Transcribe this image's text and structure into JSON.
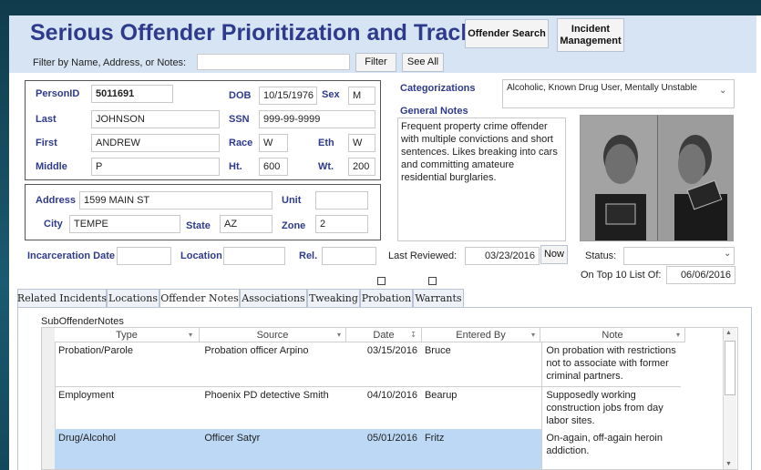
{
  "app": {
    "title": "Serious Offender Prioritization and Tracking"
  },
  "header": {
    "offender_search": "Offender Search",
    "incident_management": "Incident Management",
    "filter_label": "Filter by Name, Address, or Notes:",
    "filter_value": "",
    "filter_button": "Filter",
    "see_all_button": "See All"
  },
  "person": {
    "person_id_label": "PersonID",
    "person_id": "5011691",
    "dob_label": "DOB",
    "dob": "10/15/1976",
    "sex_label": "Sex",
    "sex": "M",
    "last_label": "Last",
    "last": "JOHNSON",
    "ssn_label": "SSN",
    "ssn": "999-99-9999",
    "first_label": "First",
    "first": "ANDREW",
    "race_label": "Race",
    "race": "W",
    "eth_label": "Eth",
    "eth": "W",
    "middle_label": "Middle",
    "middle": "P",
    "ht_label": "Ht.",
    "ht": "600",
    "wt_label": "Wt.",
    "wt": "200"
  },
  "address": {
    "address_label": "Address",
    "address": "1599 MAIN ST",
    "unit_label": "Unit",
    "unit": "",
    "city_label": "City",
    "city": "TEMPE",
    "state_label": "State",
    "state": "AZ",
    "zone_label": "Zone",
    "zone": "2"
  },
  "incarceration": {
    "date_label": "Incarceration Date",
    "date": "",
    "location_label": "Location",
    "location": "",
    "rel_label": "Rel.",
    "rel": ""
  },
  "categorizations": {
    "label": "Categorizations",
    "value": "Alcoholic, Known Drug User, Mentally Unstable"
  },
  "general_notes": {
    "label": "General Notes",
    "text": "Frequent property crime offender with multiple convictions and short sentences. Likes breaking into cars and committing amateure residential burglaries."
  },
  "review": {
    "last_reviewed_label": "Last Reviewed:",
    "last_reviewed": "03/23/2016",
    "now_button": "Now",
    "status_label": "Status:",
    "status": "",
    "top10_label": "On Top 10 List Of:",
    "top10_date": "06/06/2016"
  },
  "tabs": [
    {
      "label": "Related Incidents",
      "active": false
    },
    {
      "label": "Locations",
      "active": false
    },
    {
      "label": "Offender Notes",
      "active": true
    },
    {
      "label": "Associations",
      "active": false
    },
    {
      "label": "Tweaking",
      "active": false
    },
    {
      "label": "Probation",
      "active": false
    },
    {
      "label": "Warrants",
      "active": false
    }
  ],
  "subform": {
    "title": "SubOffenderNotes",
    "columns": [
      "Type",
      "Source",
      "Date",
      "Entered By",
      "Note"
    ],
    "rows": [
      {
        "type": "Probation/Parole",
        "source": "Probation officer Arpino",
        "date": "03/15/2016",
        "entered_by": "Bruce",
        "note": "On probation with restrictions not to associate with former criminal partners."
      },
      {
        "type": "Employment",
        "source": "Phoenix PD detective Smith",
        "date": "04/10/2016",
        "entered_by": "Bearup",
        "note": "Supposedly working construction jobs from day labor sites."
      },
      {
        "type": "Drug/Alcohol",
        "source": "Officer Satyr",
        "date": "05/01/2016",
        "entered_by": "Fritz",
        "note": "On-again, off-again heroin addiction."
      }
    ]
  },
  "colors": {
    "title": "#2e3a8c",
    "header_bg": "#d6e4f4",
    "selected_row": "#bcd8f5",
    "page_bg": "#1c4f63"
  }
}
